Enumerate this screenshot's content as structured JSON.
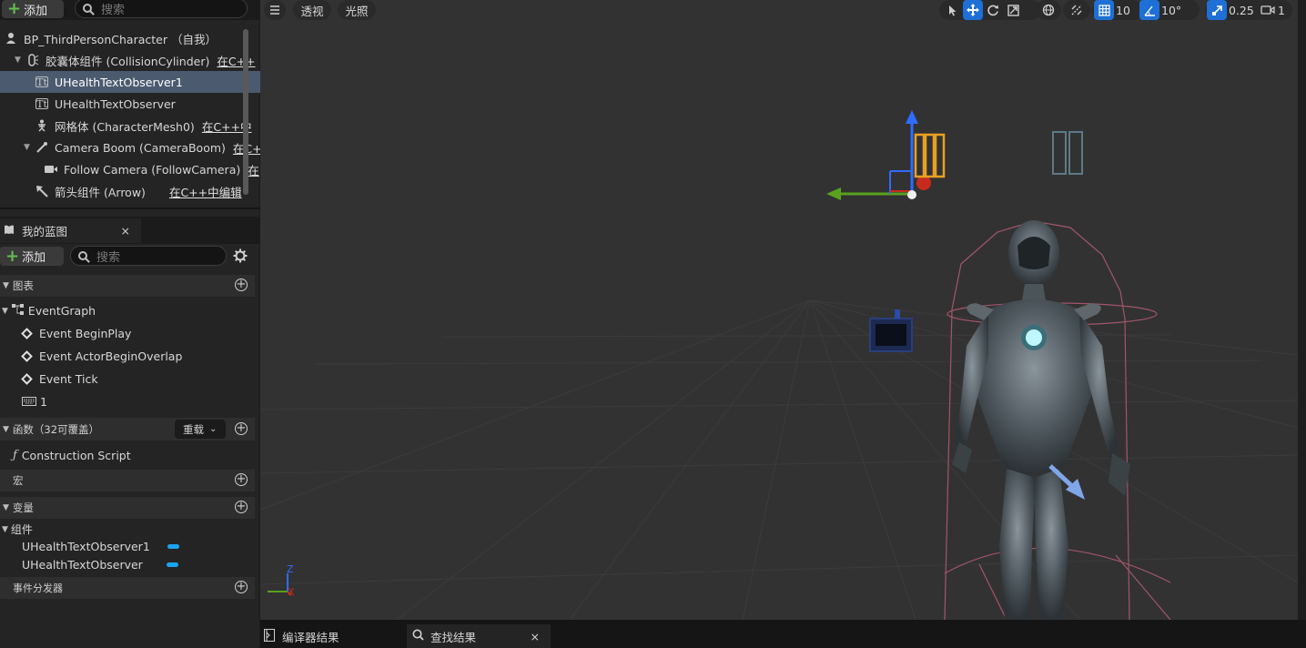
{
  "components": {
    "add_label": "添加",
    "search_placeholder": "搜索",
    "tree": [
      {
        "label": "BP_ThirdPersonCharacter （自我）",
        "link": ""
      },
      {
        "label": "胶囊体组件 (CollisionCylinder)",
        "link": "在C++"
      },
      {
        "label": "UHealthTextObserver1",
        "link": ""
      },
      {
        "label": "UHealthTextObserver",
        "link": ""
      },
      {
        "label": "网格体 (CharacterMesh0)",
        "link": "在C++中"
      },
      {
        "label": "Camera Boom (CameraBoom)",
        "link": "在C+"
      },
      {
        "label": "Follow Camera (FollowCamera)",
        "link": "在"
      },
      {
        "label": "箭头组件 (Arrow)",
        "link": "在C++中编辑"
      }
    ]
  },
  "my_blueprint": {
    "tab_label": "我的蓝图",
    "close": "×",
    "add_label": "添加",
    "search_placeholder": "搜索",
    "graphs_header": "图表",
    "graph_name": "EventGraph",
    "events": [
      "Event BeginPlay",
      "Event ActorBeginOverlap",
      "Event Tick"
    ],
    "key_item": "1",
    "functions_header": "函数（32可覆盖）",
    "override_label": "重载",
    "construction_script": "Construction Script",
    "macros_header": "宏",
    "variables_header": "变量",
    "components_category": "组件",
    "variables": [
      "UHealthTextObserver1",
      "UHealthTextObserver"
    ],
    "dispatchers_header": "事件分发器"
  },
  "viewport": {
    "perspective_label": "透视",
    "lit_label": "光照",
    "grid_size": "10",
    "rotation_snap": "10°",
    "scale_snap": "0.25",
    "camera_speed": "1",
    "axis_z": "Z",
    "axis_x": "X"
  },
  "bottom_tabs": {
    "compiler_results": "编译器结果",
    "find_results": "查找结果",
    "close": "×"
  },
  "colors": {
    "selection": "#4b5a6f",
    "accent_blue": "#1e6fd6",
    "variable_pill": "#1ca3ef",
    "add_plus": "#5fc24d"
  }
}
